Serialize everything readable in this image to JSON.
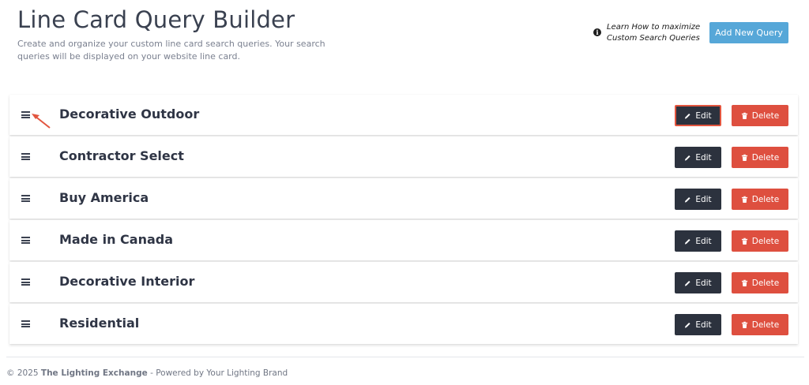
{
  "header": {
    "title": "Line Card Query Builder",
    "subtitle": "Create and organize your custom line card search queries. Your search queries will be displayed on your website line card.",
    "help_link_text": "Learn How to maximize Custom Search Queries",
    "add_button_label": "Add New Query"
  },
  "queries": [
    {
      "title": "Decorative Outdoor",
      "edit_label": "Edit",
      "delete_label": "Delete"
    },
    {
      "title": "Contractor Select",
      "edit_label": "Edit",
      "delete_label": "Delete"
    },
    {
      "title": "Buy America",
      "edit_label": "Edit",
      "delete_label": "Delete"
    },
    {
      "title": "Made in Canada",
      "edit_label": "Edit",
      "delete_label": "Delete"
    },
    {
      "title": "Decorative Interior",
      "edit_label": "Edit",
      "delete_label": "Delete"
    },
    {
      "title": "Residential",
      "edit_label": "Edit",
      "delete_label": "Delete"
    }
  ],
  "footer": {
    "copyright": "© 2025",
    "company": "The Lighting Exchange",
    "powered_by": "- Powered by Your Lighting Brand"
  },
  "icons": {
    "info": "info-icon",
    "drag_handle": "drag-handle-icon",
    "edit": "pencil-icon",
    "delete": "trash-icon",
    "annotation": "arrow-icon"
  },
  "colors": {
    "primary_button": "#56a7d8",
    "edit_button": "#2c323e",
    "delete_button": "#de4f3f",
    "highlight": "#e2553f"
  }
}
